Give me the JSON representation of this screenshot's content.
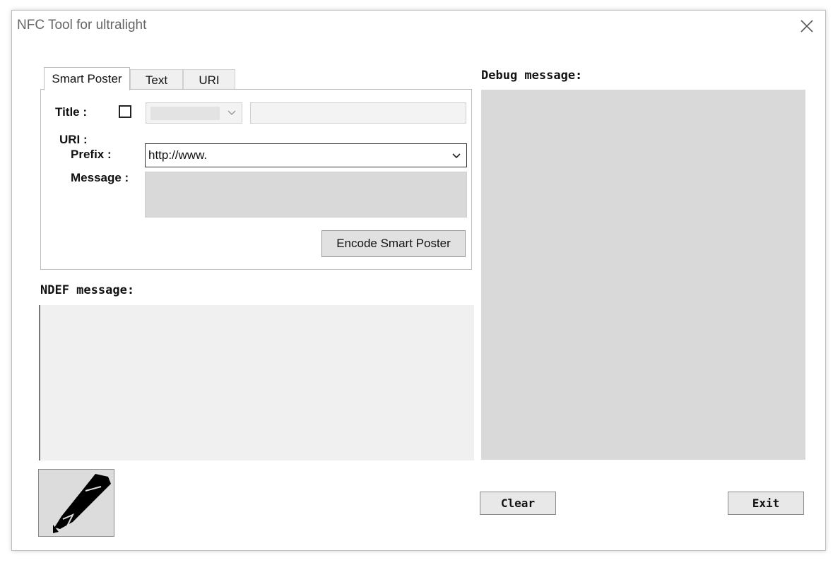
{
  "window": {
    "title": "NFC Tool for ultralight"
  },
  "tabs": [
    {
      "label": "Smart Poster",
      "active": true
    },
    {
      "label": "Text",
      "active": false
    },
    {
      "label": "URI",
      "active": false
    }
  ],
  "smart_poster": {
    "title_label": "Title :",
    "uri_label": "URI :",
    "prefix_label": "Prefix :",
    "prefix_value": "http://www.",
    "message_label": "Message :",
    "encode_button": "Encode Smart Poster"
  },
  "ndef": {
    "label": "NDEF message:"
  },
  "debug": {
    "label": "Debug message:"
  },
  "buttons": {
    "clear": "Clear",
    "exit": "Exit"
  },
  "icons": {
    "close": "close-icon",
    "pencil": "pencil-icon",
    "chevron": "chevron-down-icon"
  }
}
